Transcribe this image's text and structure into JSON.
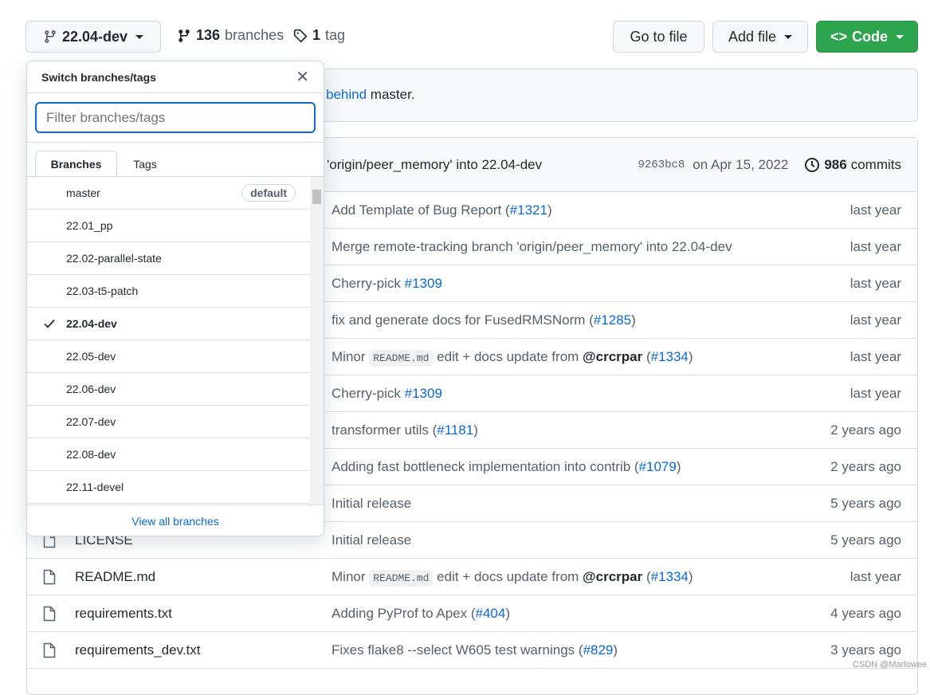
{
  "toolbar": {
    "branch": "22.04-dev",
    "branches_count": "136",
    "branches_label": "branches",
    "tags_count": "1",
    "tags_label": "tag",
    "go_to_file": "Go to file",
    "add_file": "Add file",
    "code": "Code",
    "code_color": "#2da44e"
  },
  "banner": {
    "link": "behind",
    "text": " master."
  },
  "latest_commit": {
    "message": "'origin/peer_memory' into 22.04-dev",
    "sha": "9263bc8",
    "date": "on Apr 15, 2022",
    "commits_count": "986",
    "commits_label": "commits"
  },
  "files": [
    {
      "name": "",
      "msg": [
        "Add Template of Bug Report (",
        "#1321",
        ")"
      ],
      "age": "last year"
    },
    {
      "name": "",
      "msg": [
        "Merge remote-tracking branch 'origin/peer_memory' into 22.04-dev",
        "",
        ""
      ],
      "age": "last year"
    },
    {
      "name": "",
      "msg": [
        "Cherry-pick ",
        "#1309",
        ""
      ],
      "age": "last year"
    },
    {
      "name": "",
      "msg": [
        "fix and generate docs for FusedRMSNorm (",
        "#1285",
        ")"
      ],
      "age": "last year"
    },
    {
      "name": "",
      "readme": true,
      "age": "last year"
    },
    {
      "name": "",
      "msg": [
        "Cherry-pick ",
        "#1309",
        ""
      ],
      "age": "last year"
    },
    {
      "name": "",
      "msg": [
        "transformer utils (",
        "#1181",
        ")"
      ],
      "age": "2 years ago"
    },
    {
      "name": "",
      "msg": [
        "Adding fast bottleneck implementation into contrib (",
        "#1079",
        ")"
      ],
      "age": "2 years ago"
    },
    {
      "name": "",
      "msg": [
        "Initial release",
        "",
        ""
      ],
      "age": "5 years ago"
    },
    {
      "name": "LICENSE",
      "msg": [
        "Initial release",
        "",
        ""
      ],
      "age": "5 years ago"
    },
    {
      "name": "README.md",
      "readme": true,
      "age": "last year"
    },
    {
      "name": "requirements.txt",
      "msg": [
        "Adding PyProf to Apex (",
        "#404",
        ")"
      ],
      "age": "4 years ago"
    },
    {
      "name": "requirements_dev.txt",
      "msg": [
        "Fixes flake8 --select W605 test warnings (",
        "#829",
        ")"
      ],
      "age": "3 years ago"
    }
  ],
  "readme_msg": {
    "pre": "Minor ",
    "code": "README.md",
    "mid": " edit + docs update from ",
    "user": "@crcrpar",
    "open": " (",
    "pr": "#1334",
    "close": ")"
  },
  "dropdown": {
    "title": "Switch branches/tags",
    "filter_placeholder": "Filter branches/tags",
    "tabs": [
      "Branches",
      "Tags"
    ],
    "default_badge": "default",
    "view_all": "View all branches",
    "branches": [
      "master",
      "22.01_pp",
      "22.02-parallel-state",
      "22.03-t5-patch",
      "22.04-dev",
      "22.05-dev",
      "22.06-dev",
      "22.07-dev",
      "22.08-dev",
      "22.11-devel"
    ],
    "selected": "22.04-dev"
  },
  "watermark": "CSDN @Marlowee"
}
